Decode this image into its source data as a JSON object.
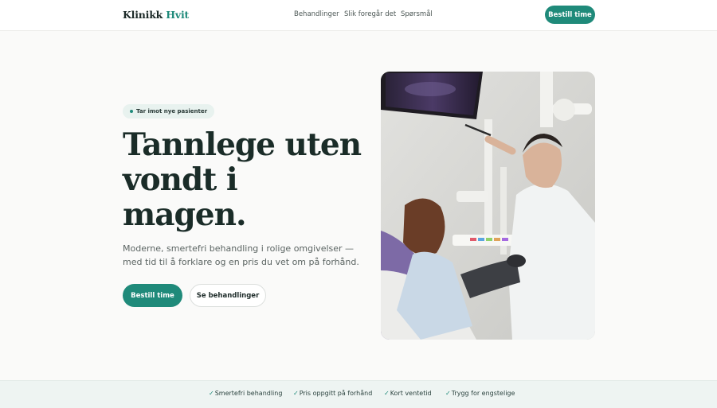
{
  "header": {
    "logo_main": "Klinikk",
    "logo_accent": "Hvit",
    "nav": [
      "Behandlinger",
      "Slik foregår det",
      "Spørsmål"
    ],
    "cta": "Bestill time"
  },
  "hero": {
    "badge": "Tar imot nye pasienter",
    "headline_lines": [
      "Tannlege uten",
      "vondt i",
      "magen."
    ],
    "lede": "Moderne, smertefri behandling i rolige omgivelser — med tid til å forklare og en pris du vet om på forhånd.",
    "primary_cta": "Bestill time",
    "secondary_cta": "Se behandlinger",
    "image_icon": "dentist-photo"
  },
  "benefits": {
    "check_icon": "✓",
    "items": [
      "Smertefri behandling",
      "Pris oppgitt på forhånd",
      "Kort ventetid",
      "Trygg for engstelige"
    ]
  },
  "colors": {
    "accent": "#1f8a7a",
    "text": "#1c2a28",
    "strip_bg": "#eef4f2"
  }
}
